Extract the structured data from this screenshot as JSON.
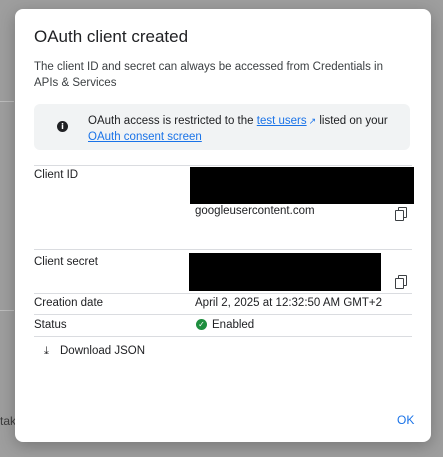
{
  "background": {
    "partial_text": "tak"
  },
  "dialog": {
    "title": "OAuth client created",
    "subtitle": "The client ID and secret can always be accessed from Credentials in APIs & Services",
    "info": {
      "icon": "info-icon",
      "text_before": "OAuth access is restricted to the ",
      "link1": "test users",
      "text_middle": " listed on your ",
      "link2": "OAuth consent screen"
    },
    "client_id": {
      "label": "Client ID",
      "value_suffix": "googleusercontent.com"
    },
    "client_secret": {
      "label": "Client secret"
    },
    "creation_date": {
      "label": "Creation date",
      "value": "April 2, 2025 at 12:32:50 AM GMT+2"
    },
    "status": {
      "label": "Status",
      "value": "Enabled",
      "color": "#1e8e3e"
    },
    "download_label": "Download JSON",
    "ok_label": "OK",
    "accent": "#1a73e8"
  }
}
